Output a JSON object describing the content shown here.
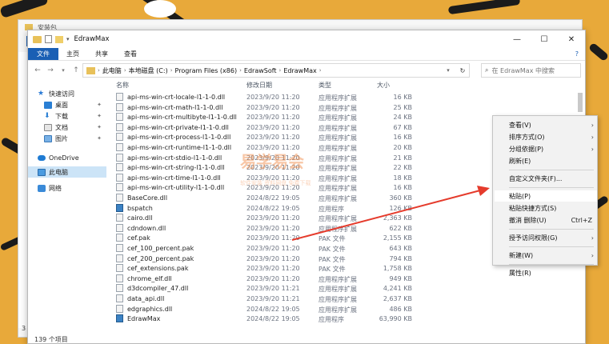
{
  "back_window": {
    "title": "安装包",
    "file_tab": "文件",
    "item_count": "3"
  },
  "window": {
    "title": "EdrawMax",
    "controls": {
      "minimize": "—",
      "maximize": "☐",
      "close": "✕"
    }
  },
  "ribbon": {
    "tabs": [
      "文件",
      "主页",
      "共享",
      "查看"
    ],
    "help": "?"
  },
  "address": {
    "crumbs": [
      "此电脑",
      "本地磁盘 (C:)",
      "Program Files (x86)",
      "EdrawSoft",
      "EdrawMax"
    ],
    "search_placeholder": "在 EdrawMax 中搜索"
  },
  "sidebar": {
    "items": [
      {
        "label": "快速访问",
        "icon": "star-icon"
      },
      {
        "label": "桌面",
        "icon": "desktop-icon",
        "pinned": true
      },
      {
        "label": "下载",
        "icon": "download-icon",
        "pinned": true
      },
      {
        "label": "文档",
        "icon": "document-icon",
        "pinned": true
      },
      {
        "label": "图片",
        "icon": "picture-icon",
        "pinned": true
      },
      {
        "label": "OneDrive",
        "icon": "cloud-icon"
      },
      {
        "label": "此电脑",
        "icon": "computer-icon",
        "selected": true
      },
      {
        "label": "网络",
        "icon": "network-icon"
      }
    ]
  },
  "columns": {
    "name": "名称",
    "date": "修改日期",
    "type": "类型",
    "size": "大小"
  },
  "files": [
    {
      "name": "api-ms-win-crt-locale-l1-1-0.dll",
      "date": "2023/9/20 11:20",
      "type": "应用程序扩展",
      "size": "16 KB"
    },
    {
      "name": "api-ms-win-crt-math-l1-1-0.dll",
      "date": "2023/9/20 11:20",
      "type": "应用程序扩展",
      "size": "25 KB"
    },
    {
      "name": "api-ms-win-crt-multibyte-l1-1-0.dll",
      "date": "2023/9/20 11:20",
      "type": "应用程序扩展",
      "size": "24 KB"
    },
    {
      "name": "api-ms-win-crt-private-l1-1-0.dll",
      "date": "2023/9/20 11:20",
      "type": "应用程序扩展",
      "size": "67 KB"
    },
    {
      "name": "api-ms-win-crt-process-l1-1-0.dll",
      "date": "2023/9/20 11:20",
      "type": "应用程序扩展",
      "size": "16 KB"
    },
    {
      "name": "api-ms-win-crt-runtime-l1-1-0.dll",
      "date": "2023/9/20 11:20",
      "type": "应用程序扩展",
      "size": "20 KB"
    },
    {
      "name": "api-ms-win-crt-stdio-l1-1-0.dll",
      "date": "2023/9/20 11:20",
      "type": "应用程序扩展",
      "size": "21 KB"
    },
    {
      "name": "api-ms-win-crt-string-l1-1-0.dll",
      "date": "2023/9/20 11:20",
      "type": "应用程序扩展",
      "size": "22 KB"
    },
    {
      "name": "api-ms-win-crt-time-l1-1-0.dll",
      "date": "2023/9/20 11:20",
      "type": "应用程序扩展",
      "size": "18 KB"
    },
    {
      "name": "api-ms-win-crt-utility-l1-1-0.dll",
      "date": "2023/9/20 11:20",
      "type": "应用程序扩展",
      "size": "16 KB"
    },
    {
      "name": "BaseCore.dll",
      "date": "2024/8/22 19:05",
      "type": "应用程序扩展",
      "size": "360 KB"
    },
    {
      "name": "bspatch",
      "date": "2024/8/22 19:05",
      "type": "应用程序",
      "size": "126 KB"
    },
    {
      "name": "cairo.dll",
      "date": "2023/9/20 11:20",
      "type": "应用程序扩展",
      "size": "2,363 KB"
    },
    {
      "name": "cdndown.dll",
      "date": "2023/9/20 11:20",
      "type": "应用程序扩展",
      "size": "622 KB"
    },
    {
      "name": "cef.pak",
      "date": "2023/9/20 11:20",
      "type": "PAK 文件",
      "size": "2,155 KB"
    },
    {
      "name": "cef_100_percent.pak",
      "date": "2023/9/20 11:20",
      "type": "PAK 文件",
      "size": "643 KB"
    },
    {
      "name": "cef_200_percent.pak",
      "date": "2023/9/20 11:20",
      "type": "PAK 文件",
      "size": "794 KB"
    },
    {
      "name": "cef_extensions.pak",
      "date": "2023/9/20 11:20",
      "type": "PAK 文件",
      "size": "1,758 KB"
    },
    {
      "name": "chrome_elf.dll",
      "date": "2023/9/20 11:20",
      "type": "应用程序扩展",
      "size": "949 KB"
    },
    {
      "name": "d3dcompiler_47.dll",
      "date": "2023/9/20 11:21",
      "type": "应用程序扩展",
      "size": "4,241 KB"
    },
    {
      "name": "data_api.dll",
      "date": "2023/9/20 11:21",
      "type": "应用程序扩展",
      "size": "2,637 KB"
    },
    {
      "name": "edgraphics.dll",
      "date": "2024/8/22 19:05",
      "type": "应用程序扩展",
      "size": "486 KB"
    },
    {
      "name": "EdrawMax",
      "date": "2024/8/22 19:05",
      "type": "应用程序",
      "size": "63,990 KB"
    }
  ],
  "status": {
    "item_count": "139 个项目"
  },
  "context_menu": {
    "items": [
      {
        "label": "查看(V)",
        "submenu": true
      },
      {
        "label": "排序方式(O)",
        "submenu": true
      },
      {
        "label": "分组依据(P)",
        "submenu": true
      },
      {
        "label": "刷新(E)"
      },
      {
        "sep": true
      },
      {
        "label": "自定义文件夹(F)..."
      },
      {
        "sep": true
      },
      {
        "label": "粘贴(P)",
        "highlighted": true
      },
      {
        "label": "粘贴快捷方式(S)"
      },
      {
        "label": "撤消 删除(U)",
        "shortcut": "Ctrl+Z"
      },
      {
        "sep": true
      },
      {
        "label": "授予访问权限(G)",
        "submenu": true
      },
      {
        "sep": true
      },
      {
        "label": "新建(W)",
        "submenu": true
      },
      {
        "sep": true
      },
      {
        "label": "属性(R)"
      }
    ]
  },
  "watermark": {
    "main": "易学易会",
    "sub": "软件安装 资料网盘 免费下载"
  },
  "colors": {
    "accent": "#1a5fb4",
    "annotation": "#e53b2c",
    "background": "#e8a93a"
  }
}
